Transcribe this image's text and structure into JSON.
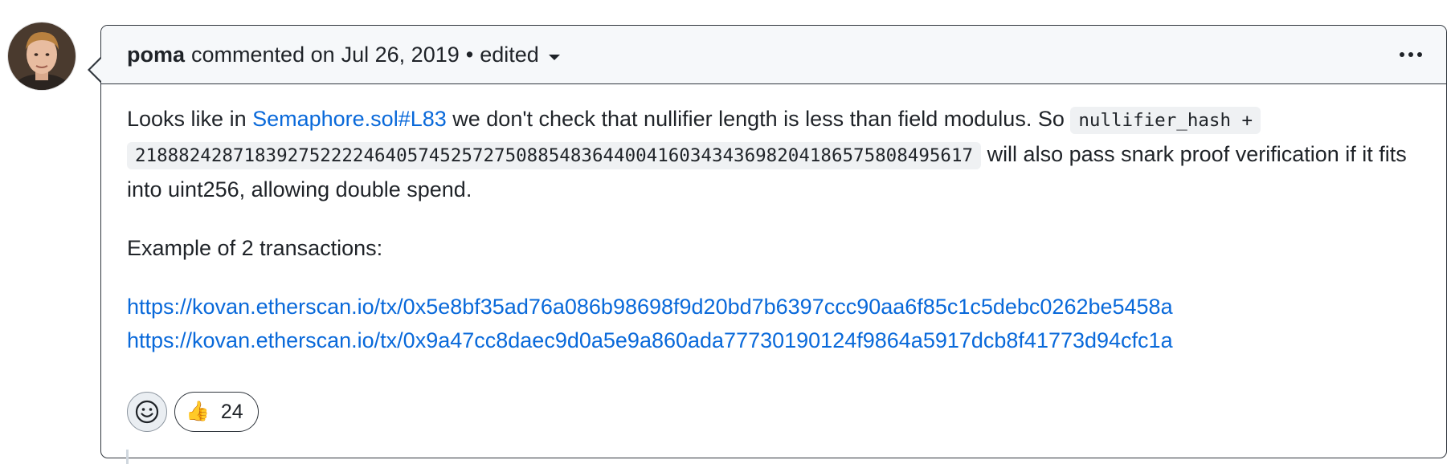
{
  "comment": {
    "author": "poma",
    "action": "commented on",
    "date": "Jul 26, 2019",
    "separator": "•",
    "edited_label": "edited",
    "body": {
      "p1_part1": "Looks like in ",
      "p1_link": "Semaphore.sol#L83",
      "p1_part2": " we don't check that nullifier length is less than field modulus. So ",
      "p1_code1": "nullifier_hash +",
      "p1_code2": "21888242871839275222246405745257275088548364400416034343698204186575808495617",
      "p1_part3": " will also pass snark proof verification if it fits into uint256, allowing double spend.",
      "p2": "Example of 2 transactions:",
      "links": [
        "https://kovan.etherscan.io/tx/0x5e8bf35ad76a086b98698f9d20bd7b6397ccc90aa6f85c1c5debc0262be5458a",
        "https://kovan.etherscan.io/tx/0x9a47cc8daec9d0a5e9a860ada77730190124f9864a5917dcb8f41773d94cfc1a"
      ]
    },
    "reactions": [
      {
        "emoji": "👍",
        "count": "24"
      }
    ]
  },
  "colors": {
    "link": "#0969da",
    "header_bg": "#f6f8fa",
    "border": "#30363d",
    "text": "#1f2328"
  },
  "icons": {
    "avatar": "avatar",
    "menu": "kebab-horizontal-icon",
    "add_reaction": "smiley-icon",
    "dropdown": "caret-down-icon"
  }
}
